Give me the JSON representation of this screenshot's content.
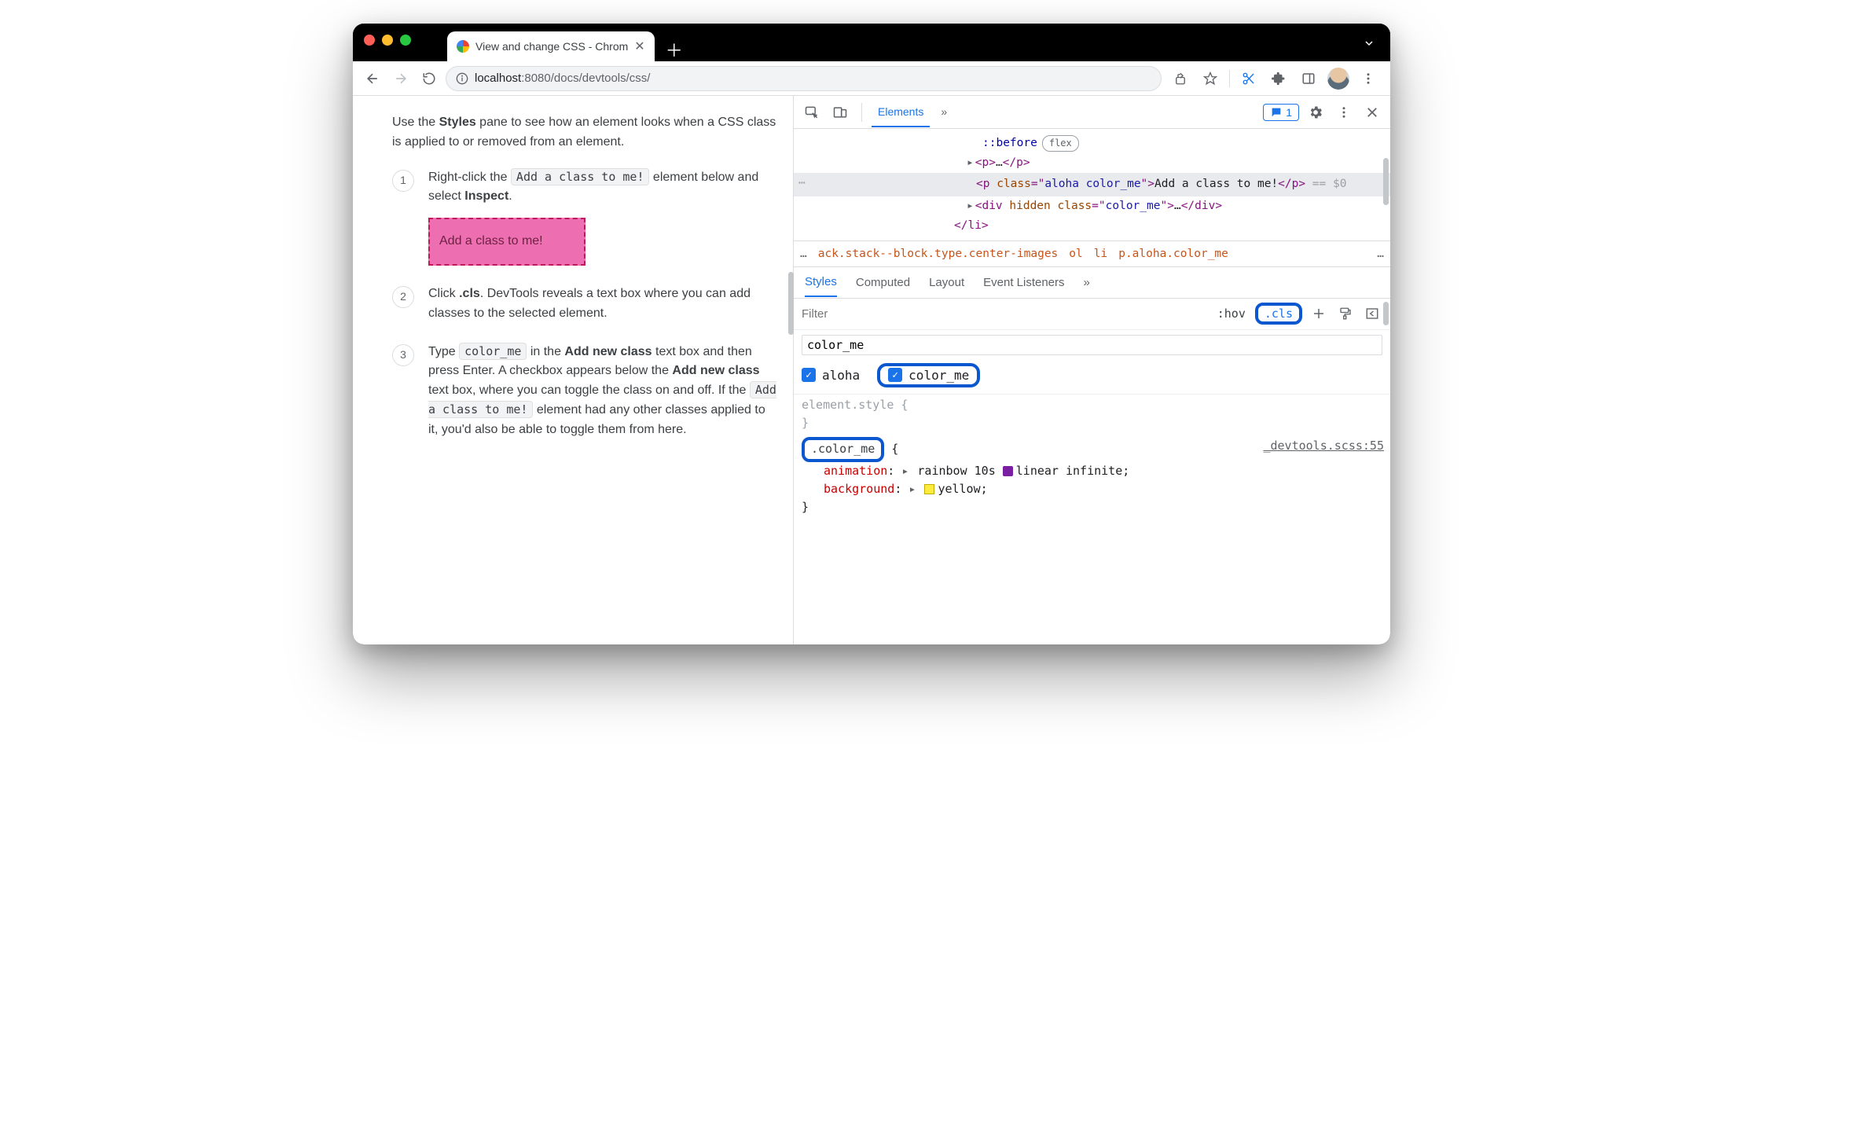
{
  "window": {
    "tab_title": "View and change CSS - Chrom",
    "url_host": "localhost",
    "url_port": ":8080",
    "url_path": "/docs/devtools/css/"
  },
  "page": {
    "intro_pre": "Use the ",
    "intro_bold": "Styles",
    "intro_post": " pane to see how an element looks when a CSS class is applied to or removed from an element.",
    "step1_pre": "Right-click the ",
    "step1_code": "Add a class to me!",
    "step1_mid": " element below and select ",
    "step1_bold": "Inspect",
    "step1_dot": ".",
    "demo_text": "Add a class to me!",
    "step2_pre": "Click ",
    "step2_bold": ".cls",
    "step2_post": ". DevTools reveals a text box where you can add classes to the selected element.",
    "step3_pre": "Type ",
    "step3_code1": "color_me",
    "step3_mid1": " in the ",
    "step3_bold1": "Add new class",
    "step3_mid2": " text box and then press Enter. A checkbox appears below the ",
    "step3_bold2": "Add new class",
    "step3_mid3": " text box, where you can toggle the class on and off. If the ",
    "step3_code2": "Add a class to me!",
    "step3_post": " element had any other classes applied to it, you'd also be able to toggle them from here.",
    "num1": "1",
    "num2": "2",
    "num3": "3"
  },
  "devtools": {
    "tabs": {
      "elements": "Elements",
      "more": "»"
    },
    "issues_count": "1",
    "dom": {
      "before": "::before",
      "flex": "flex",
      "p_collapsed": "<p>…</p>",
      "sel_open": "<p class=\"aloha color_me\">",
      "sel_text": "Add a class to me!",
      "sel_close": "</p>",
      "eq0": " == $0",
      "div_hidden": "<div hidden class=\"color_me\">…</div>",
      "li_close": "</li>"
    },
    "crumbs": {
      "dots": "…",
      "long": "ack.stack--block.type.center-images",
      "ol": "ol",
      "li": "li",
      "sel": "p.aloha.color_me",
      "end": "…"
    },
    "subtabs": {
      "styles": "Styles",
      "computed": "Computed",
      "layout": "Layout",
      "ev": "Event Listeners",
      "more": "»"
    },
    "filter": {
      "placeholder": "Filter",
      "hov": ":hov",
      "cls": ".cls"
    },
    "addclass_value": "color_me",
    "toggles": {
      "aloha": "aloha",
      "color_me": "color_me"
    },
    "rules": {
      "element_style": "element.style {",
      "close": "}",
      "color_me_sel": ".color_me",
      "open_brace": " {",
      "src": "_devtools.scss:55",
      "anim_prop": "animation",
      "anim_val": "rainbow 10s ",
      "anim_val2": "linear infinite;",
      "bg_prop": "background",
      "bg_val": "yellow;"
    }
  }
}
